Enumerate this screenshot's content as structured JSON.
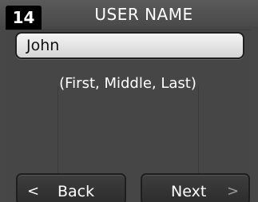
{
  "header": {
    "step": "14",
    "title": "USER NAME"
  },
  "name_field": {
    "value": "John"
  },
  "hint": "(First, Middle, Last)",
  "buttons": {
    "back": {
      "arrow": "<",
      "label": "Back"
    },
    "next": {
      "label": "Next",
      "arrow": ">"
    }
  },
  "colors": {
    "background": "#474747",
    "badge": "#000000",
    "field": "#e8e8e8",
    "button": "#333333"
  }
}
